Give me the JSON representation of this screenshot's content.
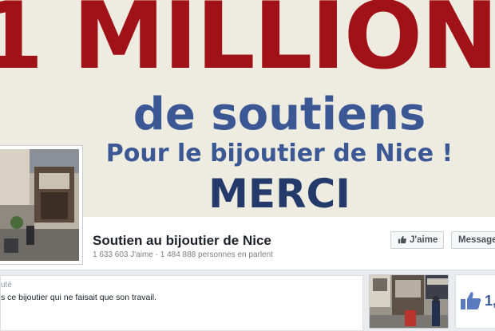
{
  "cover": {
    "title": "1 MILLION",
    "subtitle": "de soutiens",
    "line": "Pour le bijoutier de Nice !",
    "thanks": "MERCI"
  },
  "page": {
    "name": "Soutien au bijoutier de Nice",
    "stats": "1 633 603 J'aime · 1 484 888 personnes en parlent"
  },
  "actions": {
    "like_label": "J'aime",
    "message_label": "Message"
  },
  "about": {
    "label": "uté",
    "text": "s ce bijoutier qui ne faisait que son travail."
  },
  "likes": {
    "count": "1,"
  },
  "colors": {
    "cover_bg": "#eeece1",
    "title_red": "#a01218",
    "facebook_blue": "#3b5998"
  }
}
